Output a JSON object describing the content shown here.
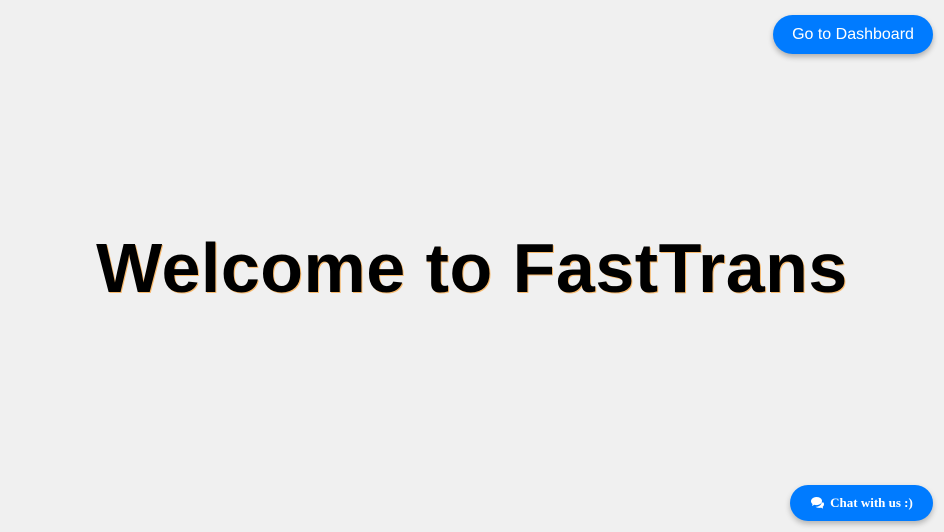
{
  "header": {
    "dashboard_label": "Go to Dashboard"
  },
  "main": {
    "title": "Welcome to FastTrans"
  },
  "chat": {
    "label": "Chat with us :)",
    "icon": "comments-icon"
  },
  "colors": {
    "background": "#f0f0f0",
    "accent": "#007bff",
    "button_text": "#ffffff",
    "title_text": "#000000"
  }
}
